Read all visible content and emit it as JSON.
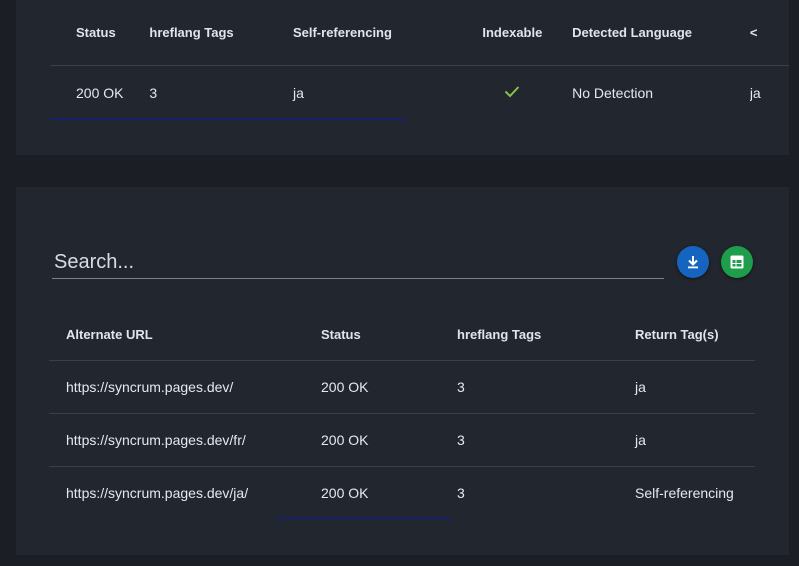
{
  "top_table": {
    "headers": [
      "Status",
      "hreflang Tags",
      "Self-referencing",
      "Indexable",
      "Detected Language",
      "<"
    ],
    "row": {
      "status": "200 OK",
      "hreflang_tags": "3",
      "self_referencing": "ja",
      "indexable": true,
      "detected_language": "No Detection",
      "partial": "ja"
    }
  },
  "search": {
    "placeholder": "Search..."
  },
  "buttons": {
    "download_color": "#1565c0",
    "sheets_color": "#1e9e4a"
  },
  "alternates_table": {
    "headers": [
      "Alternate URL",
      "Status",
      "hreflang Tags",
      "Return Tag(s)"
    ],
    "rows": [
      [
        "https://syncrum.pages.dev/",
        "200 OK",
        "3",
        "ja"
      ],
      [
        "https://syncrum.pages.dev/fr/",
        "200 OK",
        "3",
        "ja"
      ],
      [
        "https://syncrum.pages.dev/ja/",
        "200 OK",
        "3",
        "Self-referencing"
      ]
    ]
  },
  "colors": {
    "panel": "#22262e",
    "background": "#1b1e25",
    "check": "#8bc34a",
    "scroll_indicator": "#17206b"
  }
}
